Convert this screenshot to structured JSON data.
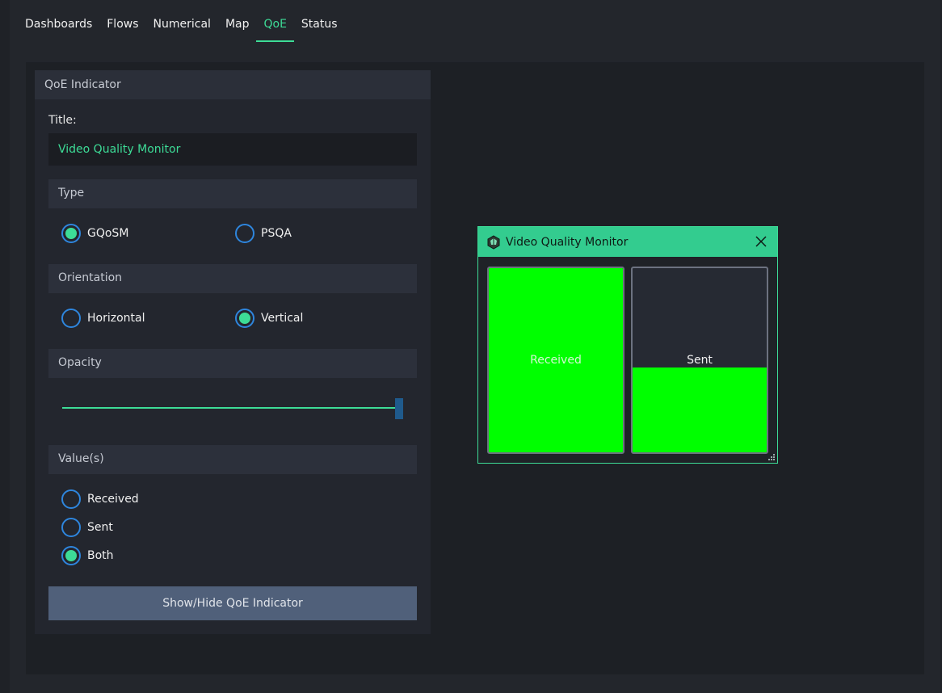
{
  "tabs": [
    {
      "label": "Dashboards"
    },
    {
      "label": "Flows"
    },
    {
      "label": "Numerical"
    },
    {
      "label": "Map"
    },
    {
      "label": "QoE"
    },
    {
      "label": "Status"
    }
  ],
  "active_tab": "QoE",
  "panel": {
    "header": "QoE Indicator",
    "title_label": "Title:",
    "title_value": "Video Quality Monitor",
    "type": {
      "header": "Type",
      "options": [
        "GQoSM",
        "PSQA"
      ],
      "selected": "GQoSM"
    },
    "orientation": {
      "header": "Orientation",
      "options": [
        "Horizontal",
        "Vertical"
      ],
      "selected": "Vertical"
    },
    "opacity": {
      "header": "Opacity",
      "value": 1.0
    },
    "values": {
      "header": "Value(s)",
      "options": [
        "Received",
        "Sent",
        "Both"
      ],
      "selected": "Both"
    },
    "button_label": "Show/Hide QoE Indicator"
  },
  "indicator_window": {
    "title": "Video Quality Monitor",
    "logo_icon": "app-logo-icon",
    "close_icon": "close-icon",
    "meters": [
      {
        "label": "Received",
        "level": 1.0
      },
      {
        "label": "Sent",
        "level": 0.46
      }
    ],
    "colors": {
      "titlebar": "#33cc8f",
      "meter_fill": "#00ff00",
      "accent": "#3ddc97",
      "radio_border": "#2e86de"
    }
  }
}
